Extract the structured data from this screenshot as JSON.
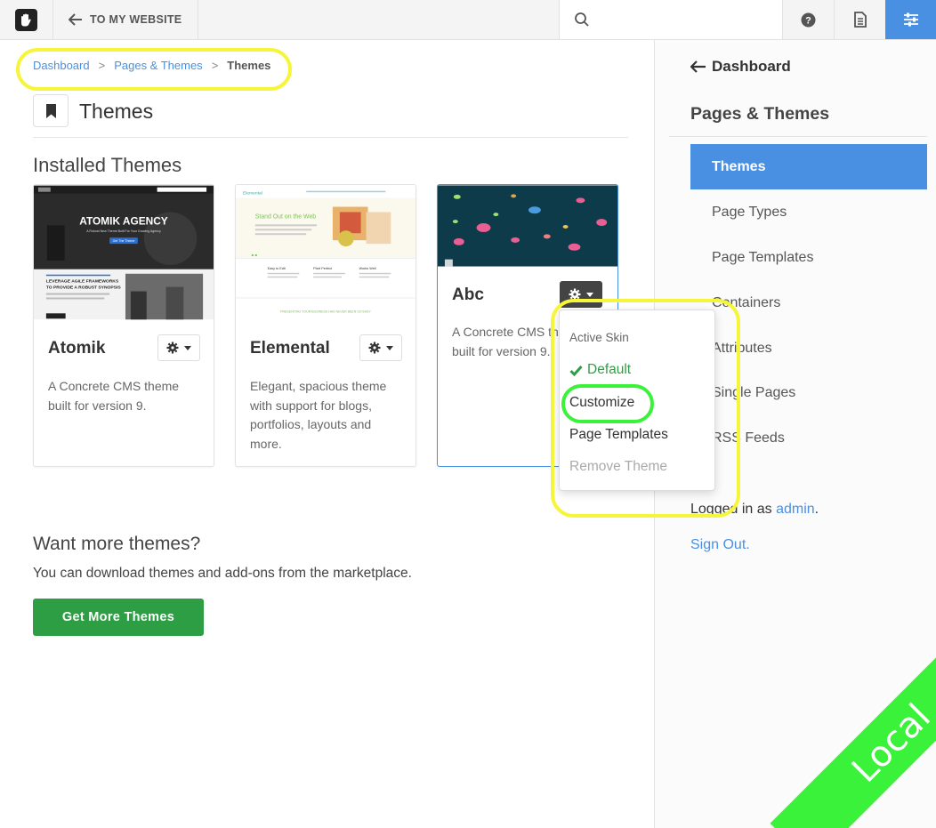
{
  "toolbar": {
    "back_label": "TO MY WEBSITE",
    "search_value": ""
  },
  "breadcrumb": {
    "items": [
      "Dashboard",
      "Pages & Themes"
    ],
    "current": "Themes",
    "separator": ">"
  },
  "page": {
    "title": "Themes",
    "installed_title": "Installed Themes"
  },
  "themes": [
    {
      "name": "Atomik",
      "description": "A Concrete CMS theme built for version 9.",
      "thumb": {
        "headline": "ATOMIK AGENCY",
        "subline": "A Robust New Theme Built For Your Growing Agency",
        "cta": "Get The Theme",
        "lower_text": "LEVERAGE AGILE FRAMEWORKS TO PROVIDE A ROBUST SYNOPSIS"
      }
    },
    {
      "name": "Elemental",
      "description": "Elegant, spacious theme with support for blogs, portfolios, layouts and more.",
      "thumb": {
        "brand": "Elemental",
        "headline": "Stand Out on the Web",
        "col1": "Easy to Edit",
        "col2": "Pixel Perfect",
        "col3": "Works Well",
        "footer": "PRESENTING YOUR BUSINESS HAS NEVER BEEN SO EASY"
      }
    },
    {
      "name": "Abc",
      "description": "A Concrete CMS theme built for version 9."
    }
  ],
  "dropdown": {
    "header": "Active Skin",
    "active_item": "Default",
    "items": [
      "Customize",
      "Page Templates"
    ],
    "disabled_item": "Remove Theme"
  },
  "more": {
    "title": "Want more themes?",
    "text": "You can download themes and add-ons from the marketplace.",
    "button": "Get More Themes"
  },
  "sidebar": {
    "back_label": "Dashboard",
    "section_title": "Pages & Themes",
    "items": [
      "Themes",
      "Page Types",
      "Page Templates",
      "Containers",
      "Attributes",
      "Single Pages",
      "RSS Feeds"
    ],
    "active_index": 0,
    "logged_prefix": "Logged in as",
    "logged_user": "admin",
    "logged_suffix": ".",
    "sign_out": "Sign Out."
  },
  "ribbon": "Local",
  "colors": {
    "accent": "#4a90e2",
    "success": "#2e9e44",
    "highlight_yellow": "#f7f53a",
    "highlight_green": "#3af23a"
  }
}
